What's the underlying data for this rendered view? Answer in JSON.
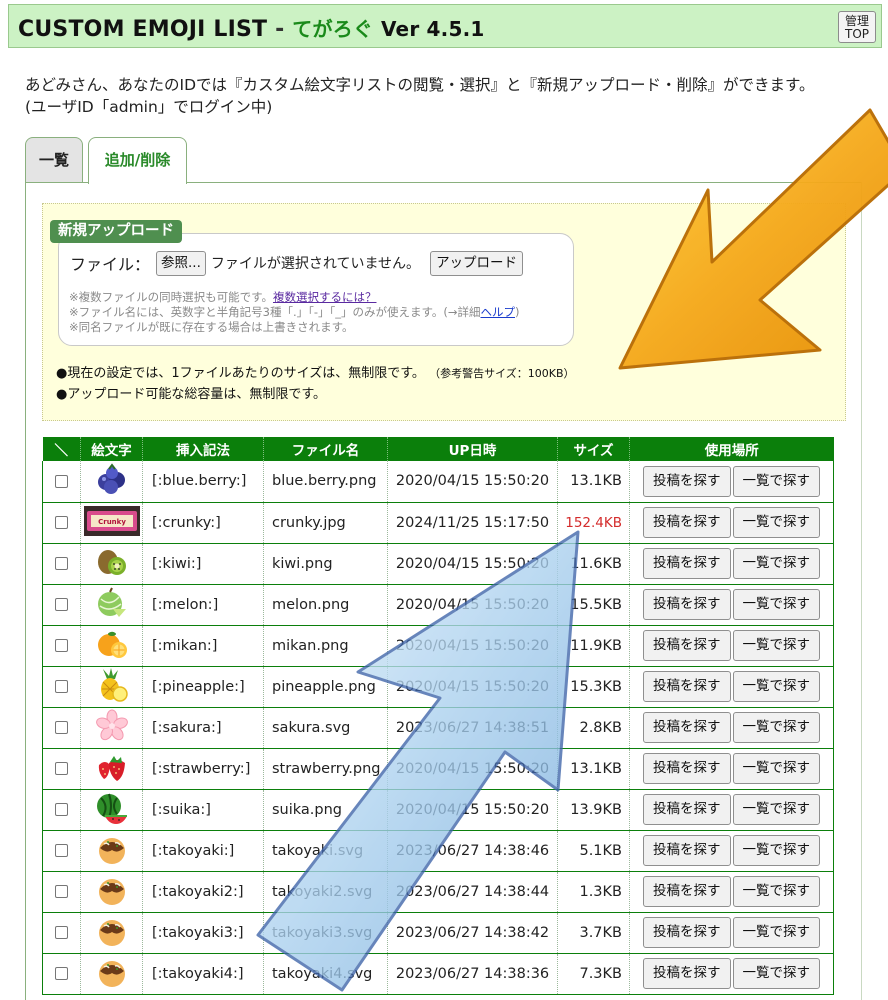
{
  "header": {
    "title": "CUSTOM EMOJI LIST",
    "separator": "-",
    "app_name": "てがろぐ",
    "version": "Ver 4.5.1",
    "admin_line1": "管理",
    "admin_line2": "TOP"
  },
  "intro": {
    "line1": "あどみさん、あなたのIDでは『カスタム絵文字リストの閲覧・選択』と『新規アップロード・削除』ができます。",
    "line2": "(ユーザID「admin」でログイン中)"
  },
  "tabs": [
    {
      "label": "一覧",
      "active": false
    },
    {
      "label": "追加/削除",
      "active": true
    }
  ],
  "upload": {
    "section_label": "新規アップロード",
    "file_label": "ファイル：",
    "browse_label": "参照...",
    "no_file_text": "ファイルが選択されていません。",
    "upload_button": "アップロード",
    "note1_prefix": "※複数ファイルの同時選択も可能です。",
    "note1_link": "複数選択するには？",
    "note2_prefix": "※ファイル名には、英数字と半角記号3種「.」「-」「_」のみが使えます。(→詳細",
    "note2_link": "ヘルプ",
    "note2_suffix": ")",
    "note3": "※同名ファイルが既に存在する場合は上書きされます。",
    "limit1": "●現在の設定では、1ファイルあたりのサイズは、無制限です。",
    "limit1_small": "（参考警告サイズ：100KB）",
    "limit2": "●アップロード可能な総容量は、無制限です。"
  },
  "table": {
    "headers": [
      "＼",
      "絵文字",
      "挿入記法",
      "ファイル名",
      "UP日時",
      "サイズ",
      "使用場所"
    ],
    "search_post_label": "投稿を探す",
    "search_list_label": "一覧で探す",
    "warn_color": "#d42c2c",
    "rows": [
      {
        "icon": "blueberry-icon",
        "code": "[:blue.berry:]",
        "file": "blue.berry.png",
        "date": "2020/04/15 15:50:20",
        "size": "13.1KB",
        "warn": false
      },
      {
        "icon": "crunky-chocolate-icon",
        "code": "[:crunky:]",
        "file": "crunky.jpg",
        "date": "2024/11/25 15:17:50",
        "size": "152.4KB",
        "warn": true
      },
      {
        "icon": "kiwi-icon",
        "code": "[:kiwi:]",
        "file": "kiwi.png",
        "date": "2020/04/15 15:50:20",
        "size": "11.6KB",
        "warn": false
      },
      {
        "icon": "melon-icon",
        "code": "[:melon:]",
        "file": "melon.png",
        "date": "2020/04/15 15:50:20",
        "size": "15.5KB",
        "warn": false
      },
      {
        "icon": "mikan-icon",
        "code": "[:mikan:]",
        "file": "mikan.png",
        "date": "2020/04/15 15:50:20",
        "size": "11.9KB",
        "warn": false
      },
      {
        "icon": "pineapple-icon",
        "code": "[:pineapple:]",
        "file": "pineapple.png",
        "date": "2020/04/15 15:50:20",
        "size": "15.3KB",
        "warn": false
      },
      {
        "icon": "sakura-icon",
        "code": "[:sakura:]",
        "file": "sakura.svg",
        "date": "2023/06/27 14:38:51",
        "size": "2.8KB",
        "warn": false
      },
      {
        "icon": "strawberry-icon",
        "code": "[:strawberry:]",
        "file": "strawberry.png",
        "date": "2020/04/15 15:50:20",
        "size": "13.1KB",
        "warn": false
      },
      {
        "icon": "suika-icon",
        "code": "[:suika:]",
        "file": "suika.png",
        "date": "2020/04/15 15:50:20",
        "size": "13.9KB",
        "warn": false
      },
      {
        "icon": "takoyaki-icon",
        "code": "[:takoyaki:]",
        "file": "takoyaki.svg",
        "date": "2023/06/27 14:38:46",
        "size": "5.1KB",
        "warn": false
      },
      {
        "icon": "takoyaki-icon",
        "code": "[:takoyaki2:]",
        "file": "takoyaki2.svg",
        "date": "2023/06/27 14:38:44",
        "size": "1.3KB",
        "warn": false
      },
      {
        "icon": "takoyaki-icon",
        "code": "[:takoyaki3:]",
        "file": "takoyaki3.svg",
        "date": "2023/06/27 14:38:42",
        "size": "3.7KB",
        "warn": false
      },
      {
        "icon": "takoyaki-icon",
        "code": "[:takoyaki4:]",
        "file": "takoyaki4.svg",
        "date": "2023/06/27 14:38:36",
        "size": "7.3KB",
        "warn": false
      }
    ]
  },
  "overlay": {
    "orange_arrow": "orange-arrow-icon",
    "blue_arrow": "blue-arrow-icon"
  }
}
